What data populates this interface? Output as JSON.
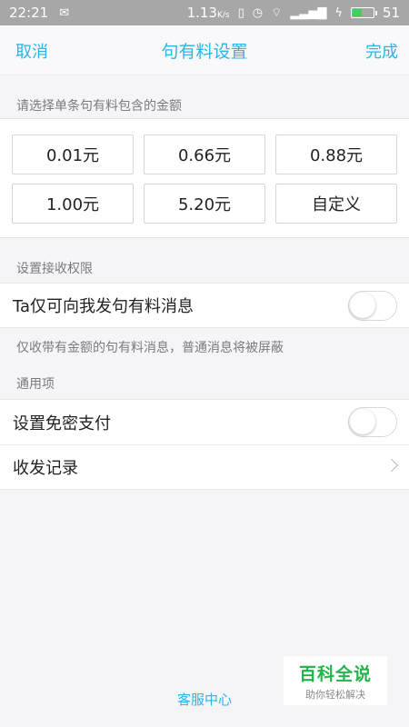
{
  "status_bar": {
    "time": "22:21",
    "net_speed": "1.13",
    "net_speed_unit": "K/s",
    "battery": "51",
    "battery_level_percent": 51,
    "icons": [
      "message-icon",
      "vibrate-icon",
      "alarm-icon",
      "wifi-icon",
      "signal-icon",
      "charging-icon",
      "battery-icon"
    ]
  },
  "nav": {
    "cancel": "取消",
    "title": "句有料设置",
    "done": "完成"
  },
  "amount": {
    "label": "请选择单条句有料包含的金额",
    "options": [
      "0.01元",
      "0.66元",
      "0.88元",
      "1.00元",
      "5.20元",
      "自定义"
    ]
  },
  "permission": {
    "label": "设置接收权限",
    "row_label": "Ta仅可向我发句有料消息",
    "toggle_on": false,
    "note": "仅收带有金额的句有料消息，普通消息将被屏蔽"
  },
  "general": {
    "label": "通用项",
    "no_password_pay": "设置免密支付",
    "no_password_toggle_on": false,
    "records": "收发记录"
  },
  "footer": {
    "service": "客服中心"
  },
  "watermark": {
    "title": "百科全说",
    "subtitle": "助你轻松解决"
  },
  "colors": {
    "accent": "#29b5e8",
    "background": "#f5f5f7",
    "watermark_green": "#24b24a"
  }
}
